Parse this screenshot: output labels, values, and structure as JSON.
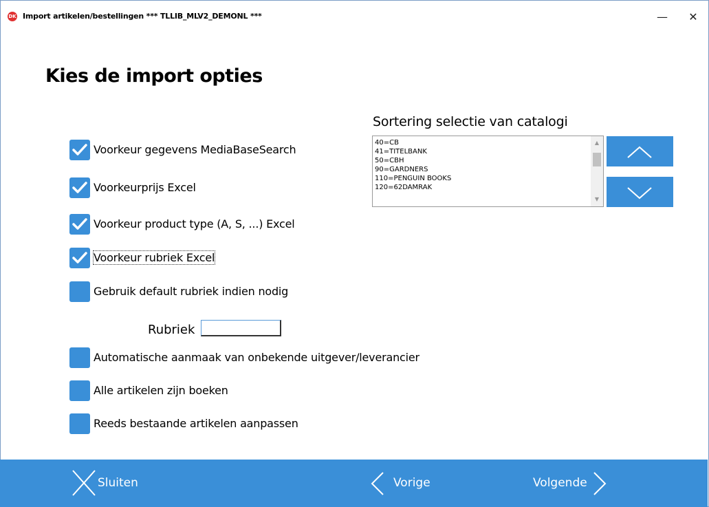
{
  "window": {
    "title": "Import artikelen/bestellingen *** TLLIB_MLV2_DEMONL ***",
    "app_icon_text": "DK",
    "minimize_symbol": "—",
    "close_symbol": "✕"
  },
  "heading": "Kies de import opties",
  "options": [
    {
      "label": "Voorkeur gegevens MediaBaseSearch",
      "checked": true
    },
    {
      "label": "Voorkeurprijs Excel",
      "checked": true
    },
    {
      "label": "Voorkeur product type (A, S, ...) Excel",
      "checked": true
    },
    {
      "label": "Voorkeur rubriek Excel",
      "checked": true
    },
    {
      "label": "Gebruik default rubriek indien nodig",
      "checked": false
    },
    {
      "label": "Automatische aanmaak van onbekende uitgever/leverancier",
      "checked": false
    },
    {
      "label": "Alle artikelen zijn boeken",
      "checked": false
    },
    {
      "label": "Reeds bestaande artikelen aanpassen",
      "checked": false
    }
  ],
  "rubriek": {
    "label": "Rubriek",
    "value": ""
  },
  "sort": {
    "title": "Sortering selectie van catalogi",
    "items": [
      "40=CB",
      "41=TITELBANK",
      "50=CBH",
      "90=GARDNERS",
      "110=PENGUIN BOOKS",
      "120=62DAMRAK"
    ]
  },
  "footer": {
    "close_label": "Sluiten",
    "prev_label": "Vorige",
    "next_label": "Volgende"
  },
  "colors": {
    "accent": "#3a8fd8",
    "white": "#ffffff"
  },
  "icons": {
    "check": "check-icon",
    "up": "chevron-up-icon",
    "down": "chevron-down-icon",
    "close": "x-icon",
    "prev": "chevron-left-icon",
    "next": "chevron-right-icon"
  }
}
